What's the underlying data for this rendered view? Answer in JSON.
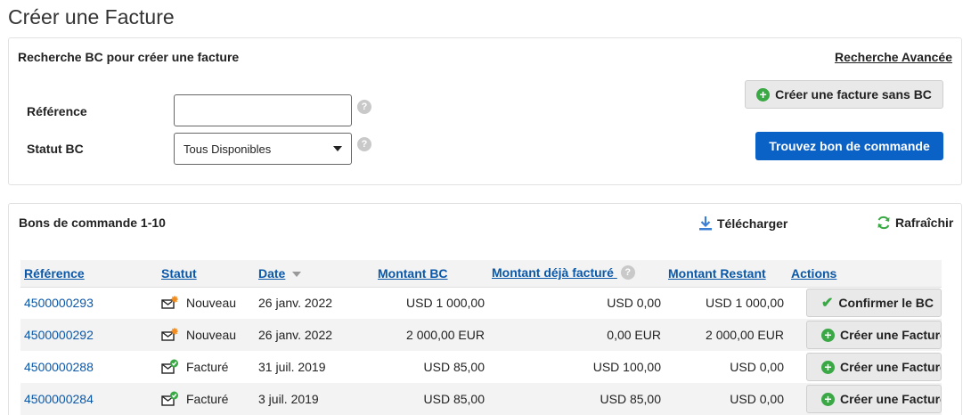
{
  "page": {
    "title": "Créer une Facture"
  },
  "search": {
    "title": "Recherche BC pour créer une facture",
    "advanced_link": "Recherche Avancée",
    "reference_label": "Référence",
    "reference_value": "",
    "status_label": "Statut BC",
    "status_value": "Tous Disponibles",
    "create_without_po_label": "Créer une facture sans BC",
    "find_po_label": "Trouvez bon de commande"
  },
  "list": {
    "title": "Bons de commande 1-10",
    "download_label": "Télécharger",
    "refresh_label": "Rafraîchir",
    "columns": {
      "reference": "Référence",
      "status": "Statut",
      "date": "Date",
      "po_amount": "Montant BC",
      "invoiced_amount": "Montant déjà facturé",
      "remaining_amount": "Montant Restant",
      "actions": "Actions"
    },
    "rows": [
      {
        "reference": "4500000293",
        "status": "Nouveau",
        "status_icon": "new-envelope-icon",
        "date": "26 janv. 2022",
        "po_amount": "USD 1 000,00",
        "invoiced": "USD 0,00",
        "remaining": "USD 1 000,00",
        "action": "Confirmer le BC",
        "action_icon": "check-icon"
      },
      {
        "reference": "4500000292",
        "status": "Nouveau",
        "status_icon": "new-envelope-icon",
        "date": "26 janv. 2022",
        "po_amount": "2 000,00 EUR",
        "invoiced": "0,00 EUR",
        "remaining": "2 000,00 EUR",
        "action": "Créer une Facture",
        "action_icon": "plus-icon"
      },
      {
        "reference": "4500000288",
        "status": "Facturé",
        "status_icon": "invoiced-envelope-icon",
        "date": "31 juil. 2019",
        "po_amount": "USD 85,00",
        "invoiced": "USD 100,00",
        "remaining": "USD 0,00",
        "action": "Créer une Facture",
        "action_icon": "plus-icon"
      },
      {
        "reference": "4500000284",
        "status": "Facturé",
        "status_icon": "invoiced-envelope-icon",
        "date": "3 juil. 2019",
        "po_amount": "USD 85,00",
        "invoiced": "USD 85,00",
        "remaining": "USD 0,00",
        "action": "Créer une Facture",
        "action_icon": "plus-icon"
      }
    ]
  },
  "colors": {
    "primary": "#0a61c6",
    "link": "#0b58a8",
    "success": "#3aa845",
    "new_badge": "#f28c1e"
  }
}
